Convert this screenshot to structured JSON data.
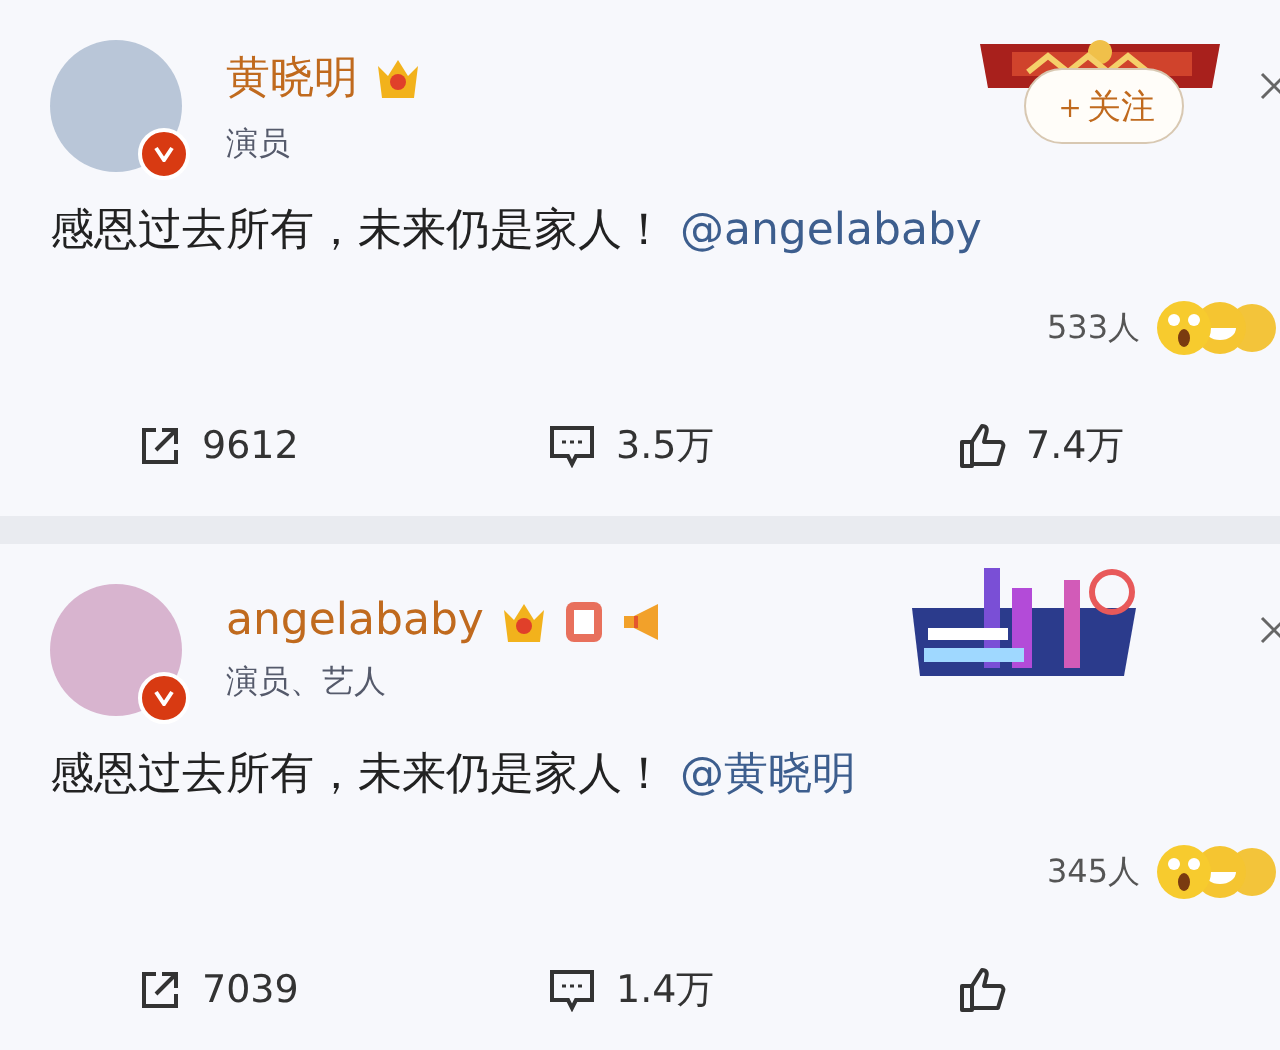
{
  "posts": [
    {
      "name": "黄晓明",
      "subtitle": "演员",
      "follow": {
        "label": "＋关注"
      },
      "text": "感恩过去所有，未来仍是家人！",
      "mention": "@angelababy",
      "reactions": "533人",
      "kind": "banner",
      "actions": [
        {
          "kind": "share",
          "count": "9612"
        },
        {
          "kind": "comment",
          "count": "3.5万"
        },
        {
          "kind": "like",
          "count": "7.4万"
        }
      ]
    },
    {
      "name": "angelababy",
      "subtitle": "演员、艺人",
      "text": "感恩过去所有，未来仍是家人！",
      "mention": "@黄晓明",
      "reactions": "345人",
      "kind": "skyline",
      "actions": [
        {
          "kind": "share",
          "count": "7039"
        },
        {
          "kind": "comment",
          "count": "1.4万"
        },
        {
          "kind": "like"
        }
      ]
    }
  ]
}
